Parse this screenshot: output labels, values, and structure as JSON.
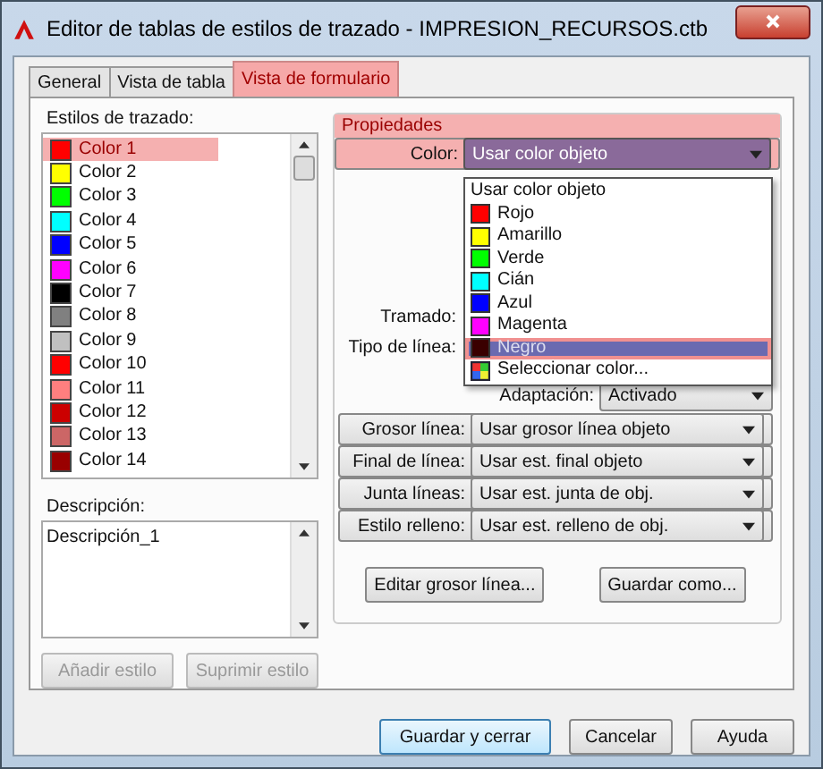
{
  "window": {
    "title": "Editor de tablas de estilos de trazado - IMPRESION_RECURSOS.ctb"
  },
  "tabs": [
    {
      "label": "General",
      "selected": false
    },
    {
      "label": "Vista de tabla",
      "selected": false
    },
    {
      "label": "Vista de formulario",
      "selected": true
    }
  ],
  "styles": {
    "label": "Estilos de trazado:",
    "items": [
      {
        "name": "Color 1",
        "color": "#ff0000",
        "selected": true
      },
      {
        "name": "Color 2",
        "color": "#ffff00",
        "selected": false
      },
      {
        "name": "Color 3",
        "color": "#00ff00",
        "selected": false
      },
      {
        "name": "Color 4",
        "color": "#00ffff",
        "selected": false
      },
      {
        "name": "Color 5",
        "color": "#0000ff",
        "selected": false
      },
      {
        "name": "Color 6",
        "color": "#ff00ff",
        "selected": false
      },
      {
        "name": "Color 7",
        "color": "#000000",
        "selected": false
      },
      {
        "name": "Color 8",
        "color": "#808080",
        "selected": false
      },
      {
        "name": "Color 9",
        "color": "#c0c0c0",
        "selected": false
      },
      {
        "name": "Color 10",
        "color": "#ff0000",
        "selected": false
      },
      {
        "name": "Color 11",
        "color": "#ff7f7f",
        "selected": false
      },
      {
        "name": "Color 12",
        "color": "#cc0000",
        "selected": false
      },
      {
        "name": "Color 13",
        "color": "#cc6666",
        "selected": false
      },
      {
        "name": "Color 14",
        "color": "#990000",
        "selected": false
      }
    ]
  },
  "description": {
    "label": "Descripción:",
    "value": "Descripción_1"
  },
  "style_buttons": [
    {
      "label": "Añadir estilo",
      "disabled": true
    },
    {
      "label": "Suprimir estilo",
      "disabled": true
    }
  ],
  "properties": {
    "title": "Propiedades",
    "highlighted": true,
    "rows": [
      {
        "kind": "combo",
        "label": "Color:",
        "value": "Usar color objeto",
        "highlighted": true
      },
      {
        "kind": "covered",
        "label": "Tramado:"
      },
      {
        "kind": "covered",
        "label": "Tipo de línea:"
      },
      {
        "kind": "combo_short",
        "label": "Adaptación:",
        "value": "Activado"
      },
      {
        "kind": "combo",
        "label": "Grosor línea:",
        "value": "Usar grosor línea objeto"
      },
      {
        "kind": "combo",
        "label": "Final de línea:",
        "value": "Usar est. final objeto"
      },
      {
        "kind": "combo",
        "label": "Junta líneas:",
        "value": "Usar est. junta de obj."
      },
      {
        "kind": "combo",
        "label": "Estilo relleno:",
        "value": "Usar est. relleno de obj."
      }
    ],
    "buttons": [
      "Editar grosor línea...",
      "Guardar como..."
    ]
  },
  "color_dropdown": {
    "options": [
      {
        "kind": "plain",
        "label": "Usar color objeto",
        "selected": false
      },
      {
        "kind": "swatch",
        "label": "Rojo",
        "color": "#ff0000",
        "selected": false
      },
      {
        "kind": "swatch",
        "label": "Amarillo",
        "color": "#ffff00",
        "selected": false
      },
      {
        "kind": "swatch",
        "label": "Verde",
        "color": "#00ff00",
        "selected": false
      },
      {
        "kind": "swatch",
        "label": "Cián",
        "color": "#00ffff",
        "selected": false
      },
      {
        "kind": "swatch",
        "label": "Azul",
        "color": "#0000ff",
        "selected": false
      },
      {
        "kind": "swatch",
        "label": "Magenta",
        "color": "#ff00ff",
        "selected": false
      },
      {
        "kind": "swatch",
        "label": "Negro",
        "color": "#3a0000",
        "selected": true
      },
      {
        "kind": "picker",
        "label": "Seleccionar color...",
        "selected": false
      }
    ]
  },
  "footer_buttons": [
    {
      "label": "Guardar y cerrar",
      "default": true
    },
    {
      "label": "Cancelar",
      "default": false
    },
    {
      "label": "Ayuda",
      "default": false
    }
  ]
}
